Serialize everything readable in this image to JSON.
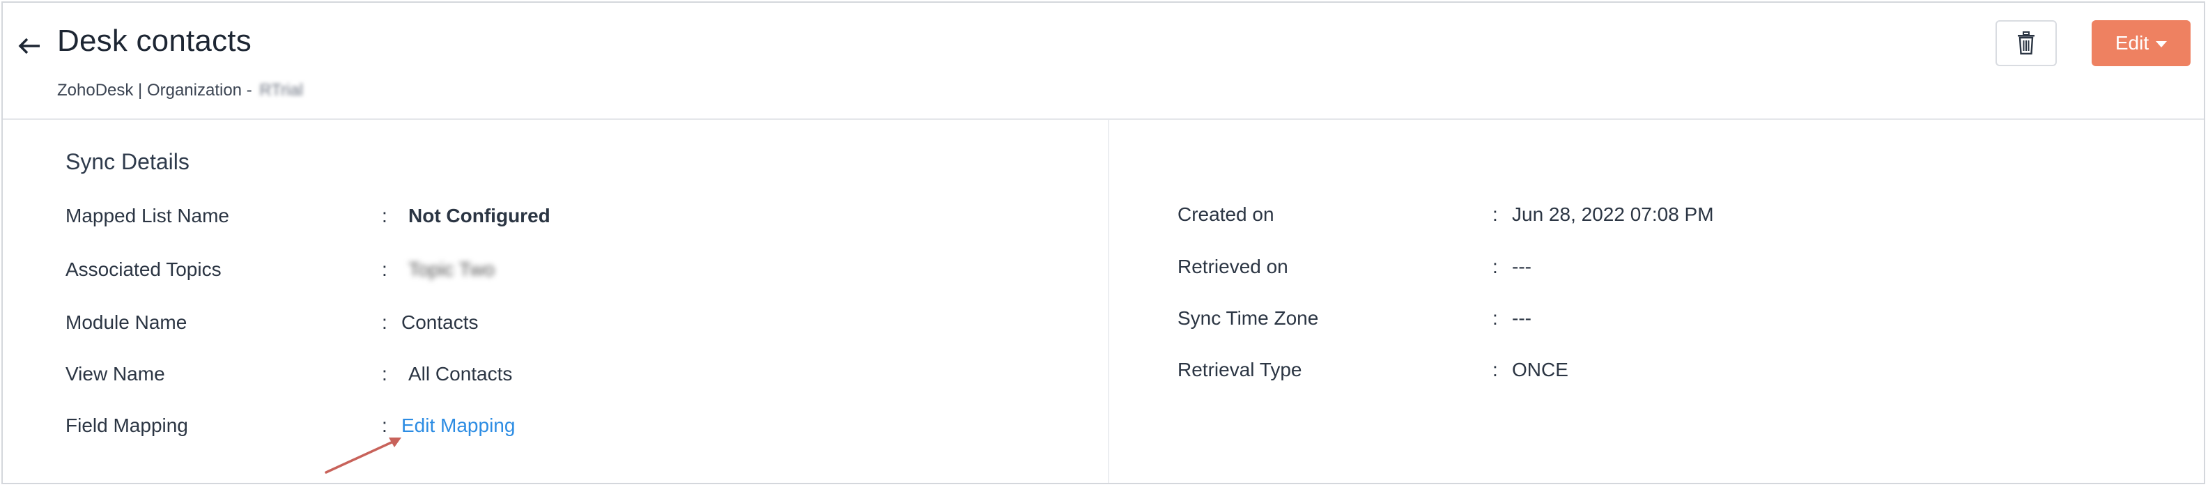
{
  "header": {
    "title": "Desk contacts",
    "subtitle_prefix": "ZohoDesk | Organization -",
    "subtitle_org": "RTrial",
    "edit_label": "Edit"
  },
  "sync": {
    "section_title": "Sync Details",
    "colon": ":",
    "left": [
      {
        "label": "Mapped List Name",
        "value": "Not Configured"
      },
      {
        "label": "Associated Topics",
        "value": "Topic Two"
      },
      {
        "label": "Module Name",
        "value": "Contacts"
      },
      {
        "label": "View Name",
        "value": "All Contacts"
      },
      {
        "label": "Field Mapping",
        "value": "Edit Mapping"
      }
    ],
    "right": [
      {
        "label": "Created on",
        "value": "Jun 28, 2022 07:08 PM"
      },
      {
        "label": "Retrieved on",
        "value": "---"
      },
      {
        "label": "Sync Time Zone",
        "value": "---"
      },
      {
        "label": "Retrieval Type",
        "value": "ONCE"
      }
    ]
  },
  "colors": {
    "accent": "#ee8161",
    "link": "#2c8ce3",
    "annotation_arrow": "#c8625a"
  }
}
